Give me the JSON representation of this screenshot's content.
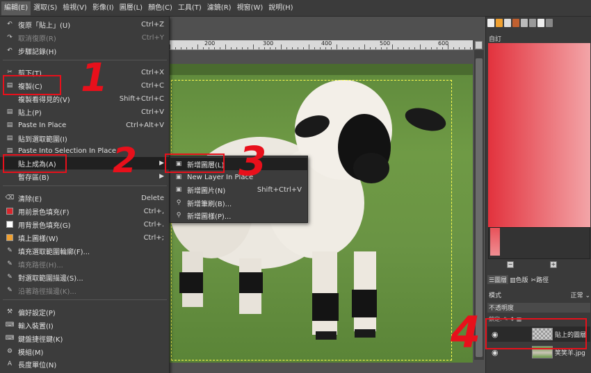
{
  "menubar": {
    "items": [
      "編輯(E)",
      "選取(S)",
      "檢視(V)",
      "影像(I)",
      "圖層(L)",
      "顏色(C)",
      "工具(T)",
      "濾鏡(R)",
      "視窗(W)",
      "說明(H)"
    ]
  },
  "ruler": {
    "labels": [
      "200",
      "300",
      "400",
      "500",
      "600"
    ]
  },
  "edit_menu": {
    "items": [
      {
        "icon": "undo-icon",
        "glyph": "↶",
        "label": "復原「貼上」(U)",
        "shortcut": "Ctrl+Z"
      },
      {
        "icon": "redo-icon",
        "glyph": "↷",
        "label": "取消復原(R)",
        "shortcut": "Ctrl+Y"
      },
      {
        "icon": "history-icon",
        "glyph": "↶",
        "label": "步驟記錄(H)",
        "shortcut": ""
      },
      {
        "icon": "cut-icon",
        "glyph": "✂",
        "label": "剪下(T)",
        "shortcut": "Ctrl+X"
      },
      {
        "icon": "copy-icon",
        "glyph": "▤",
        "label": "複製(C)",
        "shortcut": "Ctrl+C"
      },
      {
        "icon": "copy-visible-icon",
        "glyph": "",
        "label": "複製看得見的(V)",
        "shortcut": "Shift+Ctrl+C"
      },
      {
        "icon": "paste-icon",
        "glyph": "▤",
        "label": "貼上(P)",
        "shortcut": "Ctrl+V"
      },
      {
        "icon": "paste-in-place-icon",
        "glyph": "▤",
        "label": "Paste In Place",
        "shortcut": "Ctrl+Alt+V"
      },
      {
        "icon": "paste-into-selection-icon",
        "glyph": "▤",
        "label": "貼到選取範圍(I)",
        "shortcut": ""
      },
      {
        "icon": "paste-into-selection-in-place-icon",
        "glyph": "▤",
        "label": "Paste Into Selection In Place",
        "shortcut": ""
      },
      {
        "icon": "paste-as-icon",
        "glyph": "",
        "label": "貼上成為(A)",
        "shortcut": ""
      },
      {
        "icon": "buffer-icon",
        "glyph": "",
        "label": "暫存區(B)",
        "shortcut": ""
      },
      {
        "icon": "clear-icon",
        "glyph": "⌫",
        "label": "清除(E)",
        "shortcut": "Delete"
      },
      {
        "icon": "fill-fg-icon",
        "glyph": "",
        "label": "用前景色填充(F)",
        "shortcut": "Ctrl+,"
      },
      {
        "icon": "fill-bg-icon",
        "glyph": "",
        "label": "用背景色填充(G)",
        "shortcut": "Ctrl+."
      },
      {
        "icon": "fill-pattern-icon",
        "glyph": "",
        "label": "填上圖樣(W)",
        "shortcut": "Ctrl+;"
      },
      {
        "icon": "fill-selection-outline-icon",
        "glyph": "✎",
        "label": "填充選取範圍輪廓(F)...",
        "shortcut": ""
      },
      {
        "icon": "fill-path-icon",
        "glyph": "✎",
        "label": "填充路徑(H)...",
        "shortcut": ""
      },
      {
        "icon": "stroke-selection-icon",
        "glyph": "✎",
        "label": "對選取範圍描邊(S)...",
        "shortcut": ""
      },
      {
        "icon": "stroke-path-icon",
        "glyph": "✎",
        "label": "沿著路徑描邊(K)...",
        "shortcut": ""
      },
      {
        "icon": "preferences-icon",
        "glyph": "⚒",
        "label": "偏好設定(P)",
        "shortcut": ""
      },
      {
        "icon": "input-devices-icon",
        "glyph": "⌨",
        "label": "輸入裝置(I)",
        "shortcut": ""
      },
      {
        "icon": "keyboard-shortcuts-icon",
        "glyph": "⌨",
        "label": "鍵盤捷徑鍵(K)",
        "shortcut": ""
      },
      {
        "icon": "modules-icon",
        "glyph": "⚙",
        "label": "模組(M)",
        "shortcut": ""
      },
      {
        "icon": "units-icon",
        "glyph": "A",
        "label": "長度單位(N)",
        "shortcut": ""
      }
    ],
    "colors": {
      "fg": "#d8262c",
      "bg": "#ffffff",
      "pattern": "#f0a030"
    }
  },
  "paste_as_submenu": {
    "items": [
      {
        "icon": "new-layer-icon",
        "label": "新增圖層(L)",
        "shortcut": ""
      },
      {
        "icon": "new-layer-in-place-icon",
        "label": "New Layer In Place",
        "shortcut": ""
      },
      {
        "icon": "new-image-icon",
        "label": "新增圖片(N)",
        "shortcut": "Shift+Ctrl+V"
      },
      {
        "icon": "new-brush-icon",
        "label": "新增筆刷(B)...",
        "shortcut": ""
      },
      {
        "icon": "new-pattern-icon",
        "label": "新增圖樣(P)...",
        "shortcut": ""
      }
    ]
  },
  "dock": {
    "gradient_title": "自訂",
    "gradient_colors": {
      "start": "#e2323d",
      "end": "#f3a5a8"
    },
    "panel_tabs": [
      "圖層",
      "色版",
      "路徑"
    ],
    "mode_label": "模式",
    "mode_value": "正常",
    "opacity_label": "不透明度",
    "lock_label": "鎖定:",
    "layers": [
      {
        "name": "貼上的圖層",
        "selected": true
      },
      {
        "name": "笑笑羊.jpg",
        "selected": false
      }
    ]
  },
  "annotations": [
    "1",
    "2",
    "3",
    "4"
  ],
  "annotation_color": "#e8101b"
}
